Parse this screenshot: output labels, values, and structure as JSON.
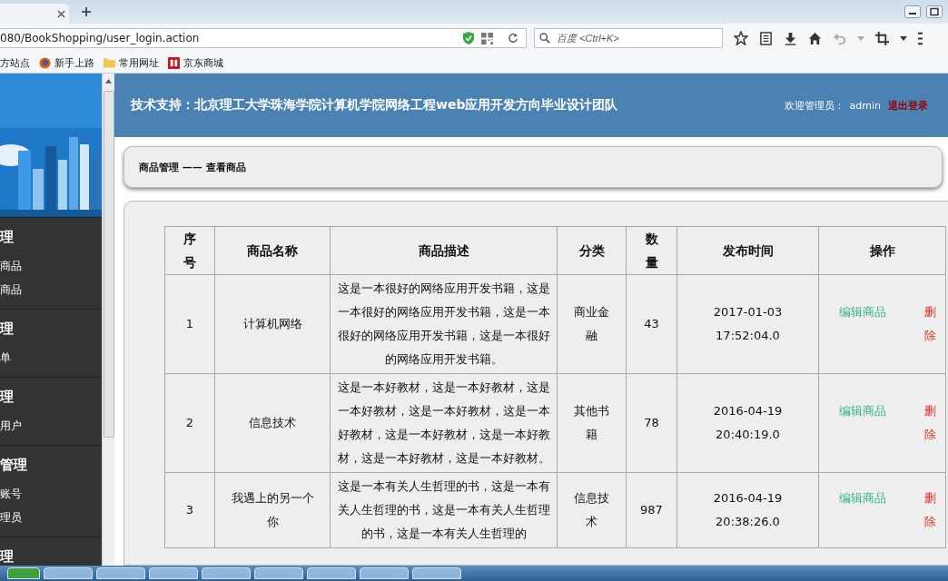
{
  "browser": {
    "url": "080/BookShopping/user_login.action",
    "search_placeholder": "百度 <Ctrl+K>",
    "bookmarks": [
      {
        "label": "方站点",
        "kind": "plain"
      },
      {
        "label": "新手上路",
        "kind": "firefox"
      },
      {
        "label": "常用网址",
        "kind": "folder"
      },
      {
        "label": "京东商城",
        "kind": "jd"
      }
    ]
  },
  "sidebar": {
    "groups": [
      {
        "title": "理",
        "items": [
          "商品",
          "商品"
        ]
      },
      {
        "title": "理",
        "items": [
          "单"
        ]
      },
      {
        "title": "理",
        "items": [
          "用户"
        ]
      },
      {
        "title": "管理",
        "items": [
          "账号",
          "理员"
        ]
      },
      {
        "title": "理"
      }
    ]
  },
  "header": {
    "title": "技术支持：北京理工大学珠海学院计算机学院网络工程web应用开发方向毕业设计团队",
    "welcome": "欢迎管理员：",
    "user": "admin",
    "logout": "退出登录"
  },
  "breadcrumb": "商品管理 —— 查看商品",
  "table": {
    "columns": [
      "序号",
      "商品名称",
      "商品描述",
      "分类",
      "数量",
      "发布时间",
      "操作"
    ],
    "rows": [
      {
        "no": "1",
        "name": "计算机网络",
        "description": "这是一本很好的网络应用开发书籍，这是一本很好的网络应用开发书籍，这是一本很好的网络应用开发书籍，这是一本很好的网络应用开发书籍。",
        "category": "商业金融",
        "quantity": "43",
        "time": "2017-01-03 17:52:04.0",
        "edit": "编辑商品",
        "delete": "删除"
      },
      {
        "no": "2",
        "name": "信息技术",
        "description": "这是一本好教材，这是一本好教材，这是一本好教材，这是一本好教材，这是一本好教材，这是一本好教材，这是一本好教材，这是一本好教材，这是一本好教材。",
        "category": "其他书籍",
        "quantity": "78",
        "time": "2016-04-19 20:40:19.0",
        "edit": "编辑商品",
        "delete": "删除"
      },
      {
        "no": "3",
        "name": "我遇上的另一个你",
        "description": "这是一本有关人生哲理的书，这是一本有关人生哲理的书，这是一本有关人生哲理的书，这是一本有关人生哲理的",
        "category": "信息技术",
        "quantity": "987",
        "time": "2016-04-19 20:38:26.0",
        "edit": "编辑商品",
        "delete": "删除"
      }
    ]
  }
}
